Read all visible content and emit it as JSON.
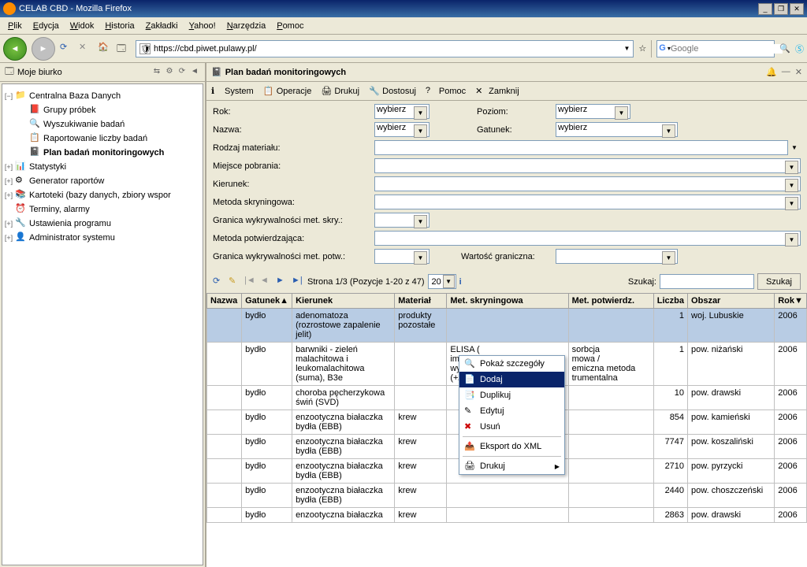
{
  "window": {
    "title": "CELAB CBD - Mozilla Firefox"
  },
  "menu": [
    "Plik",
    "Edycja",
    "Widok",
    "Historia",
    "Zakładki",
    "Yahoo!",
    "Narzędzia",
    "Pomoc"
  ],
  "url": "https://cbd.piwet.pulawy.pl/",
  "search_placeholder": "Google",
  "sidebar": {
    "title": "Moje biurko",
    "items": [
      {
        "label": "Centralna Baza Danych",
        "indent": 0,
        "exp": "−",
        "bold": false
      },
      {
        "label": "Grupy próbek",
        "indent": 1,
        "bold": false
      },
      {
        "label": "Wyszukiwanie badań",
        "indent": 1,
        "bold": false
      },
      {
        "label": "Raportowanie liczby badań",
        "indent": 1,
        "bold": false
      },
      {
        "label": "Plan badań monitoringowych",
        "indent": 1,
        "bold": true
      },
      {
        "label": "Statystyki",
        "indent": 0,
        "exp": "+",
        "bold": false
      },
      {
        "label": "Generator raportów",
        "indent": 0,
        "exp": "+",
        "bold": false
      },
      {
        "label": "Kartoteki (bazy danych, zbiory wspor",
        "indent": 0,
        "exp": "+",
        "bold": false
      },
      {
        "label": "Terminy, alarmy",
        "indent": 0,
        "bold": false
      },
      {
        "label": "Ustawienia programu",
        "indent": 0,
        "exp": "+",
        "bold": false
      },
      {
        "label": "Administrator systemu",
        "indent": 0,
        "exp": "+",
        "bold": false
      }
    ]
  },
  "main": {
    "title": "Plan badań monitoringowych",
    "toolbar": [
      {
        "label": "System",
        "icon": "info"
      },
      {
        "label": "Operacje",
        "icon": "ops"
      },
      {
        "label": "Drukuj",
        "icon": "print"
      },
      {
        "label": "Dostosuj",
        "icon": "tools"
      },
      {
        "label": "Pomoc",
        "icon": "help"
      },
      {
        "label": "Zamknij",
        "icon": "close"
      }
    ],
    "form": {
      "rok": "Rok:",
      "rok_val": "wybierz",
      "poziom": "Poziom:",
      "poziom_val": "wybierz",
      "nazwa": "Nazwa:",
      "nazwa_val": "wybierz",
      "gatunek": "Gatunek:",
      "gatunek_val": "wybierz",
      "rodzaj": "Rodzaj materiału:",
      "miejsce": "Miejsce pobrania:",
      "kierunek": "Kierunek:",
      "met_skr": "Metoda skryningowa:",
      "granica_skr": "Granica wykrywalności met. skry.:",
      "met_potw": "Metoda potwierdzająca:",
      "granica_potw": "Granica wykrywalności met. potw.:",
      "wartosc": "Wartość graniczna:"
    },
    "pagination": {
      "text": "Strona 1/3 (Pozycje 1-20 z 47)",
      "pagesize": "20",
      "szukaj": "Szukaj:",
      "szukaj_btn": "Szukaj"
    },
    "columns": [
      "Nazwa",
      "Gatunek",
      "Kierunek",
      "Materiał",
      "Met. skryningowa",
      "Met. potwierdz.",
      "Liczba",
      "Obszar",
      "Rok"
    ],
    "rows": [
      {
        "g": "bydło",
        "k": "adenomatoza (rozrostowe zapalenie jelit)",
        "m": "produkty pozostałe",
        "ms": "",
        "mp": "",
        "l": "1",
        "o": "woj. Lubuskie",
        "r": "2006",
        "sel": true
      },
      {
        "g": "bydło",
        "k": "barwniki - zieleń malachitowa i leukomalachitowa (suma), B3e",
        "m": "",
        "ms": "ELISA (\nimmun\nwykryw\n(+/-/?)",
        "mp": "sorbcja\nmowa /\nemiczna metoda\ntrumentalna",
        "l": "1",
        "o": "pow. niżański",
        "r": "2006"
      },
      {
        "g": "bydło",
        "k": "choroba pęcherzykowa świń (SVD)",
        "m": "",
        "ms": "",
        "mp": "",
        "l": "10",
        "o": "pow. drawski",
        "r": "2006"
      },
      {
        "g": "bydło",
        "k": "enzootyczna białaczka bydła (EBB)",
        "m": "krew",
        "ms": "",
        "mp": "",
        "l": "854",
        "o": "pow. kamieński",
        "r": "2006"
      },
      {
        "g": "bydło",
        "k": "enzootyczna białaczka bydła (EBB)",
        "m": "krew",
        "ms": "",
        "mp": "",
        "l": "7747",
        "o": "pow. koszaliński",
        "r": "2006"
      },
      {
        "g": "bydło",
        "k": "enzootyczna białaczka bydła (EBB)",
        "m": "krew",
        "ms": "",
        "mp": "",
        "l": "2710",
        "o": "pow. pyrzycki",
        "r": "2006"
      },
      {
        "g": "bydło",
        "k": "enzootyczna białaczka bydła (EBB)",
        "m": "krew",
        "ms": "",
        "mp": "",
        "l": "2440",
        "o": "pow. choszczeński",
        "r": "2006"
      },
      {
        "g": "bydło",
        "k": "enzootyczna białaczka",
        "m": "krew",
        "ms": "",
        "mp": "",
        "l": "2863",
        "o": "pow. drawski",
        "r": "2006"
      }
    ]
  },
  "ctx": {
    "items": [
      {
        "label": "Pokaż szczegóły",
        "icon": "🔍"
      },
      {
        "label": "Dodaj",
        "icon": "📄",
        "selected": true
      },
      {
        "label": "Duplikuj",
        "icon": "📑"
      },
      {
        "label": "Edytuj",
        "icon": "✎"
      },
      {
        "label": "Usuń",
        "icon": "✖",
        "red": true
      },
      {
        "sep": true
      },
      {
        "label": "Eksport do XML",
        "icon": "📤"
      },
      {
        "sep": true
      },
      {
        "label": "Drukuj",
        "icon": "🖨",
        "arrow": true
      }
    ]
  }
}
